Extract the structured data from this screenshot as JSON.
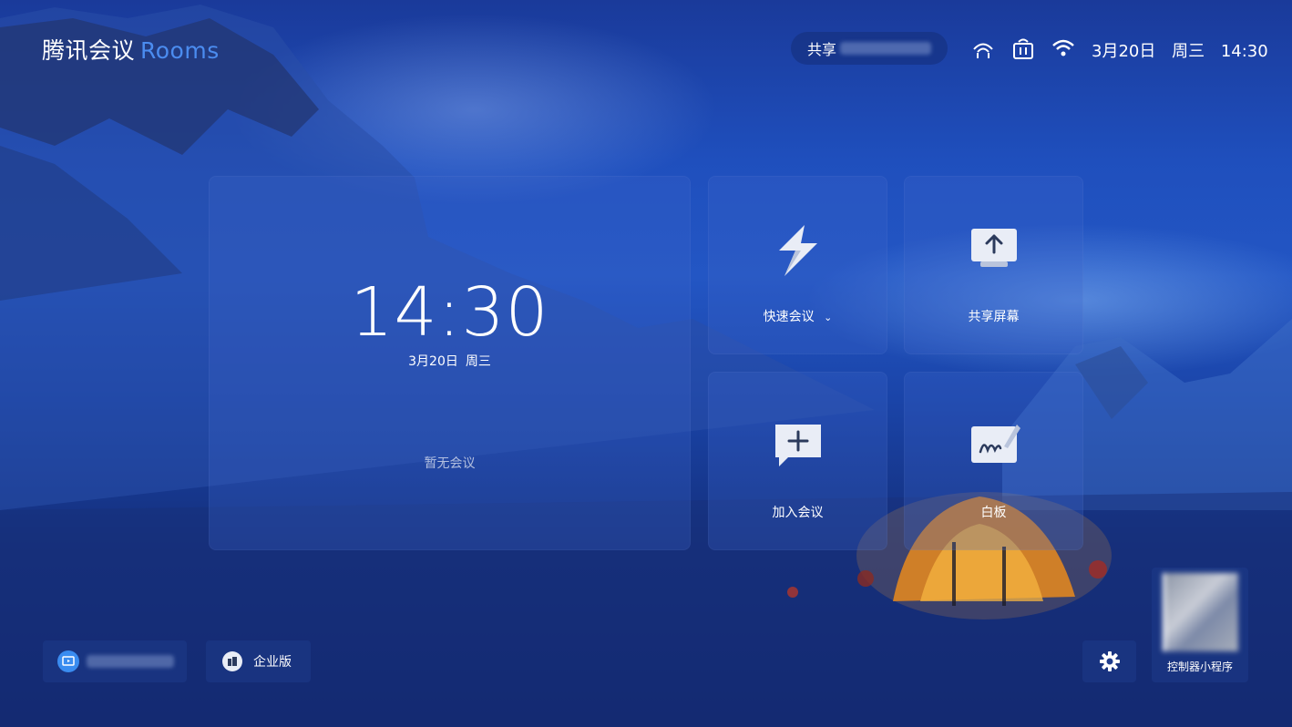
{
  "header": {
    "app_title": "腾讯会议",
    "app_suffix": "Rooms",
    "share_label": "共享",
    "date": "3月20日",
    "weekday": "周三",
    "time": "14:30"
  },
  "main_panel": {
    "clock": "14:30",
    "date": "3月20日",
    "weekday": "周三",
    "empty_text": "暂无会议"
  },
  "tiles": [
    {
      "label": "快速会议",
      "icon": "lightning-icon"
    },
    {
      "label": "共享屏幕",
      "icon": "share-screen-icon"
    },
    {
      "label": "加入会议",
      "icon": "join-meeting-icon"
    },
    {
      "label": "白板",
      "icon": "whiteboard-icon"
    }
  ],
  "footer": {
    "enterprise_label": "企业版",
    "controller_label": "控制器小程序"
  },
  "colors": {
    "accent": "#4b8cf0",
    "tile_bg": "rgba(60,100,200,0.28)"
  }
}
